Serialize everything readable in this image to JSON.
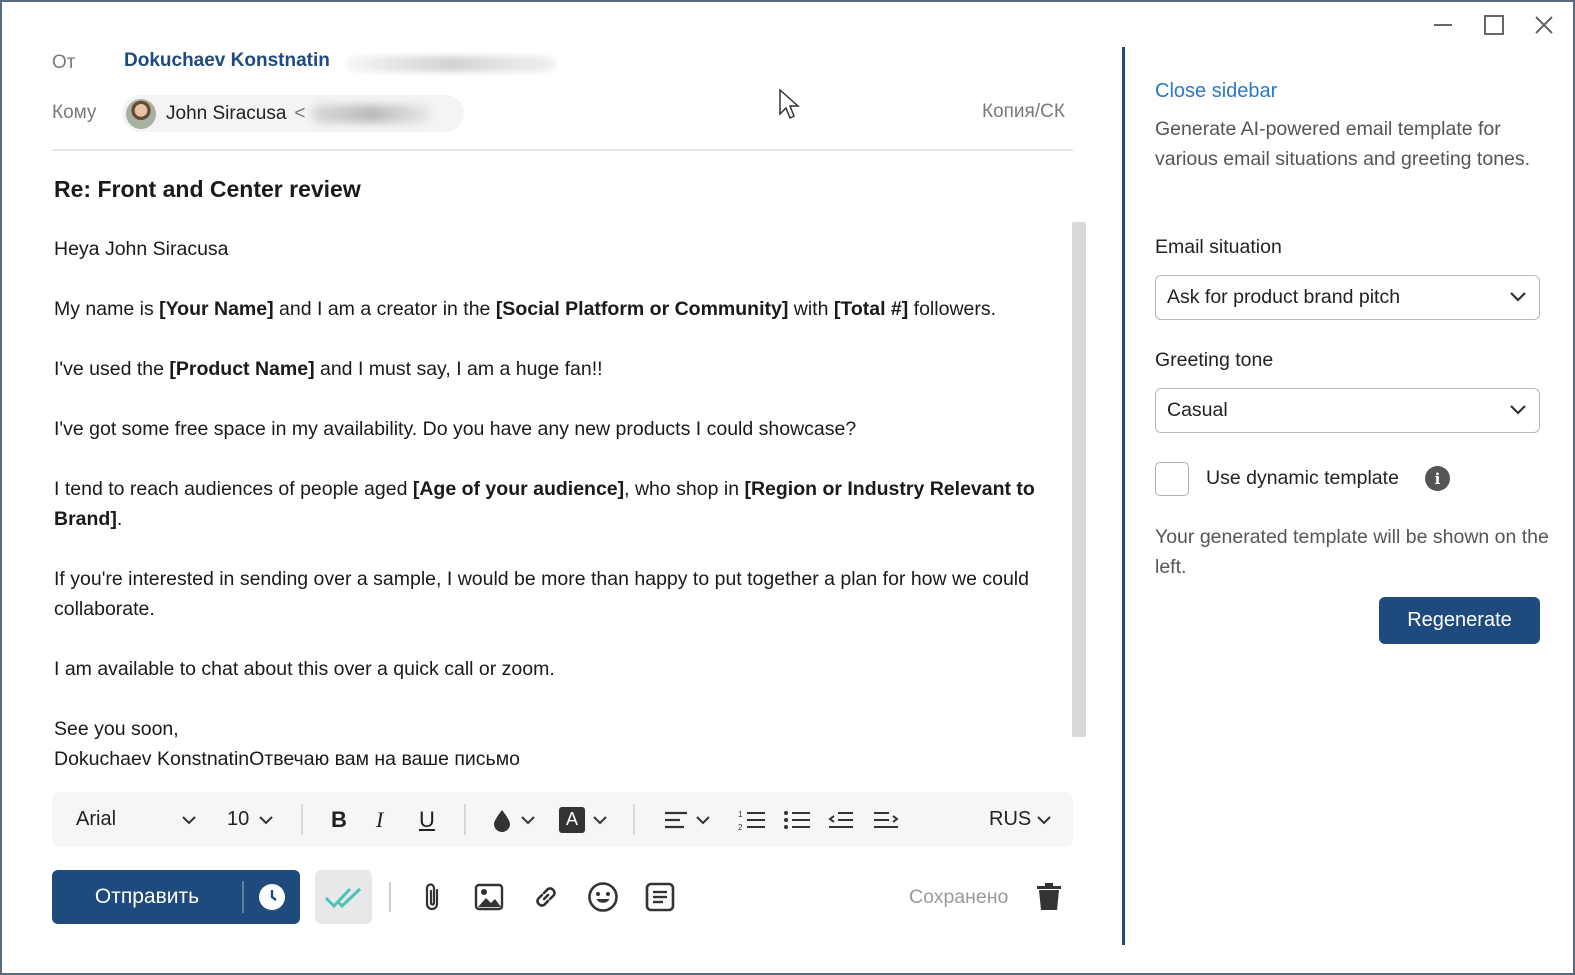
{
  "window": {
    "controls": [
      "minimize-icon",
      "maximize-icon",
      "close-icon"
    ]
  },
  "header": {
    "from_label": "От",
    "from_name": "Dokuchaev Konstnatin",
    "to_label": "Кому",
    "recipient_name": "John Siracusa",
    "recipient_email_prefix": "<",
    "cc_label": "Копия/СК"
  },
  "subject": "Re: Front and Center review",
  "body": {
    "greeting": "Heya John Siracusa",
    "p1": {
      "t1": "My name is ",
      "b1": "[Your Name]",
      "t2": " and I am a creator in the ",
      "b2": "[Social Platform or Community]",
      "t3": " with ",
      "b3": "[Total #]",
      "t4": " followers."
    },
    "p2": {
      "t1": "I've used the ",
      "b1": "[Product Name]",
      "t2": " and I must say, I am a huge fan!!"
    },
    "p3": "I've got some free space in my availability. Do you have any new products I could showcase?",
    "p4": {
      "t1": "I tend to reach audiences of people aged ",
      "b1": "[Age of your audience]",
      "t2": ", who shop in ",
      "b2": "[Region or Industry Relevant to Brand]",
      "t3": "."
    },
    "p5": "If you're interested in sending over a sample, I would be more than happy to put together a plan for how we could collaborate.",
    "p6": "I am available to chat about this over a quick call or zoom.",
    "closing": "See you soon,",
    "signature": "Dokuchaev KonstnatinОтвечаю вам на ваше письмо"
  },
  "format_toolbar": {
    "font": "Arial",
    "size": "10",
    "bold": "B",
    "italic": "I",
    "underline": "U",
    "font_color_letter": "A",
    "language": "RUS"
  },
  "actions": {
    "send_label": "Отправить",
    "saved_label": "Сохранено",
    "icons": [
      "schedule-clock-icon",
      "read-receipt-check-icon",
      "attach-icon",
      "image-icon",
      "link-icon",
      "emoji-icon",
      "template-icon",
      "trash-icon"
    ]
  },
  "sidebar": {
    "close_label": "Close sidebar",
    "description": "Generate AI-powered email template for various email situations and greeting tones.",
    "situation_label": "Email situation",
    "situation_value": "Ask for product brand pitch",
    "tone_label": "Greeting tone",
    "tone_value": "Casual",
    "dynamic_label": "Use dynamic template",
    "dynamic_checked": false,
    "note": "Your generated template will be shown on the left.",
    "regenerate_label": "Regenerate"
  },
  "colors": {
    "brand": "#1f4a7d",
    "link": "#2b78c8",
    "check": "#4cc3b3"
  }
}
